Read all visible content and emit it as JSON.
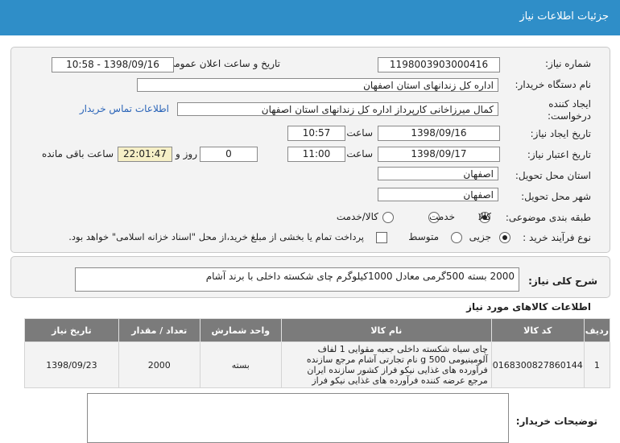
{
  "header": {
    "title": "جزئیات اطلاعات نیاز"
  },
  "fields": {
    "need_number_label": "شماره نیاز:",
    "need_number": "1198003903000416",
    "announce_label": "تاریخ و ساعت اعلان عمومی:",
    "announce_value": "1398/09/16 - 10:58",
    "buyer_label": "نام دستگاه خریدار:",
    "buyer_value": "اداره کل زندانهای استان اصفهان",
    "creator_label_1": "ایجاد کننده",
    "creator_label_2": "درخواست:",
    "creator_value": "کمال میرزاخانی کارپرداز اداره کل زندانهای استان اصفهان",
    "contact_link": "اطلاعات تماس خریدار",
    "create_date_label": "تاریخ ایجاد نیاز:",
    "create_date": "1398/09/16",
    "time_label": "ساعت",
    "create_time": "10:57",
    "validity_label": "تاریخ اعتبار نیاز:",
    "validity_date": "1398/09/17",
    "validity_time": "11:00",
    "days_value": "0",
    "days_label": "روز و",
    "remaining_time": "22:01:47",
    "remaining_label": "ساعت باقی مانده",
    "province_label": "استان محل تحویل:",
    "province_value": "اصفهان",
    "city_label": "شهر محل تحویل:",
    "city_value": "اصفهان",
    "category_label": "طبقه بندی موضوعی:",
    "category_options": [
      "کالا",
      "خدمت",
      "کالا/خدمت"
    ],
    "process_label": "نوع فرآیند خرید :",
    "process_options": [
      "جزیی",
      "متوسط"
    ],
    "payment_note": "پرداخت تمام یا بخشی از مبلغ خرید،از محل \"اسناد خزانه اسلامی\" خواهد بود."
  },
  "summary": {
    "label": "شرح کلی نیاز:",
    "value": "2000 بسته 500گرمی معادل 1000کیلوگرم چای شکسته داخلی با برند آشام"
  },
  "goods": {
    "title": "اطلاعات کالاهای مورد نیاز",
    "columns": [
      "ردیف",
      "کد کالا",
      "نام کالا",
      "واحد شمارش",
      "تعداد / مقدار",
      "تاریخ نیاز"
    ],
    "rows": [
      {
        "row": "1",
        "code": "0168300827860144",
        "name": "چای سیاه شکسته داخلی جعبه مقوایی 1 لفاف آلومینیومی 500 g نام تجارتی آشام مرجع سازنده فرآورده های غذایی نیکو فراز کشور سازنده ایران مرجع عرضه کننده فرآورده های غذایی نیکو فراز",
        "unit": "بسته",
        "qty": "2000",
        "date": "1398/09/23"
      }
    ]
  },
  "buyer_notes": {
    "label": "توضیحات خریدار:"
  }
}
